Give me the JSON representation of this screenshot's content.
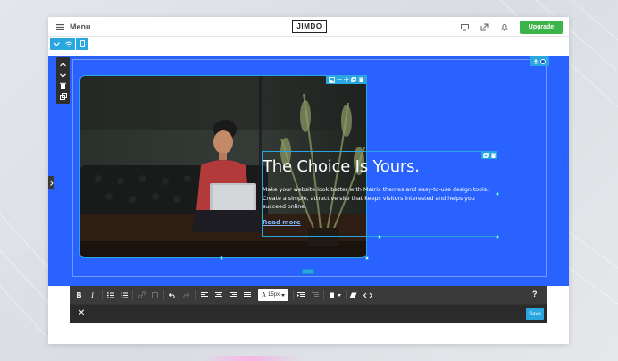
{
  "topbar": {
    "menu_label": "Menu",
    "logo_text": "JIMDO",
    "upgrade_label": "Upgrade",
    "icons": [
      "desktop-preview-icon",
      "external-link-icon",
      "bell-icon"
    ]
  },
  "device_toggle": {
    "icons": [
      "chevron-down-icon",
      "wifi-icon",
      "mobile-icon"
    ]
  },
  "section": {
    "headline": "The Choice Is Yours.",
    "body": "Make your website look better with Matrix themes and easy-to-use design tools. Create a simple, attractive site that keeps visitors interested and helps you succeed online.",
    "link": "Read more"
  },
  "editor_toolbar": {
    "font_size": "15px",
    "help": "?",
    "save_label": "Save",
    "close_label": "✕"
  },
  "colors": {
    "canvas": "#2962ff",
    "accent": "#2aa7e0",
    "upgrade": "#3cb44a",
    "toolbar": "#333333"
  }
}
